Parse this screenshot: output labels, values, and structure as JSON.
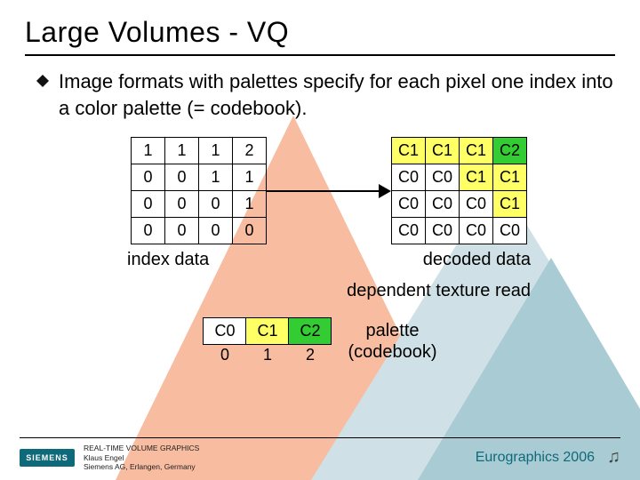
{
  "title": "Large Volumes - VQ",
  "bullet_text": "Image formats with palettes specify for each pixel one index into a color palette (= codebook).",
  "chart_data": {
    "type": "table",
    "index_grid": [
      [
        "1",
        "1",
        "1",
        "2"
      ],
      [
        "0",
        "0",
        "1",
        "1"
      ],
      [
        "0",
        "0",
        "0",
        "1"
      ],
      [
        "0",
        "0",
        "0",
        "0"
      ]
    ],
    "decoded_grid": [
      [
        "C1",
        "C1",
        "C1",
        "C2"
      ],
      [
        "C0",
        "C0",
        "C1",
        "C1"
      ],
      [
        "C0",
        "C0",
        "C0",
        "C1"
      ],
      [
        "C0",
        "C0",
        "C0",
        "C0"
      ]
    ],
    "palette": {
      "colors": [
        {
          "label": "C0",
          "hex": "#ffffff"
        },
        {
          "label": "C1",
          "hex": "#ffff66"
        },
        {
          "label": "C2",
          "hex": "#33cc33"
        }
      ],
      "indices": [
        "0",
        "1",
        "2"
      ]
    }
  },
  "captions": {
    "index": "index data",
    "decoded": "decoded data",
    "dependent": "dependent texture read",
    "palette_line1": "palette",
    "palette_line2": "(codebook)"
  },
  "footer": {
    "logo_text": "SIEMENS",
    "line1": "REAL-TIME VOLUME GRAPHICS",
    "line2": "Klaus Engel",
    "line3": "Siemens AG, Erlangen, Germany",
    "conference": "Eurographics 2006"
  },
  "colors": {
    "c0": "#ffffff",
    "c1": "#ffff66",
    "c2": "#33cc33",
    "bg_orange": "#f8bca0",
    "bg_teal_light": "#cfe1e6",
    "bg_teal_mid": "#a9cbd3",
    "accent_teal": "#0e6a7a"
  }
}
